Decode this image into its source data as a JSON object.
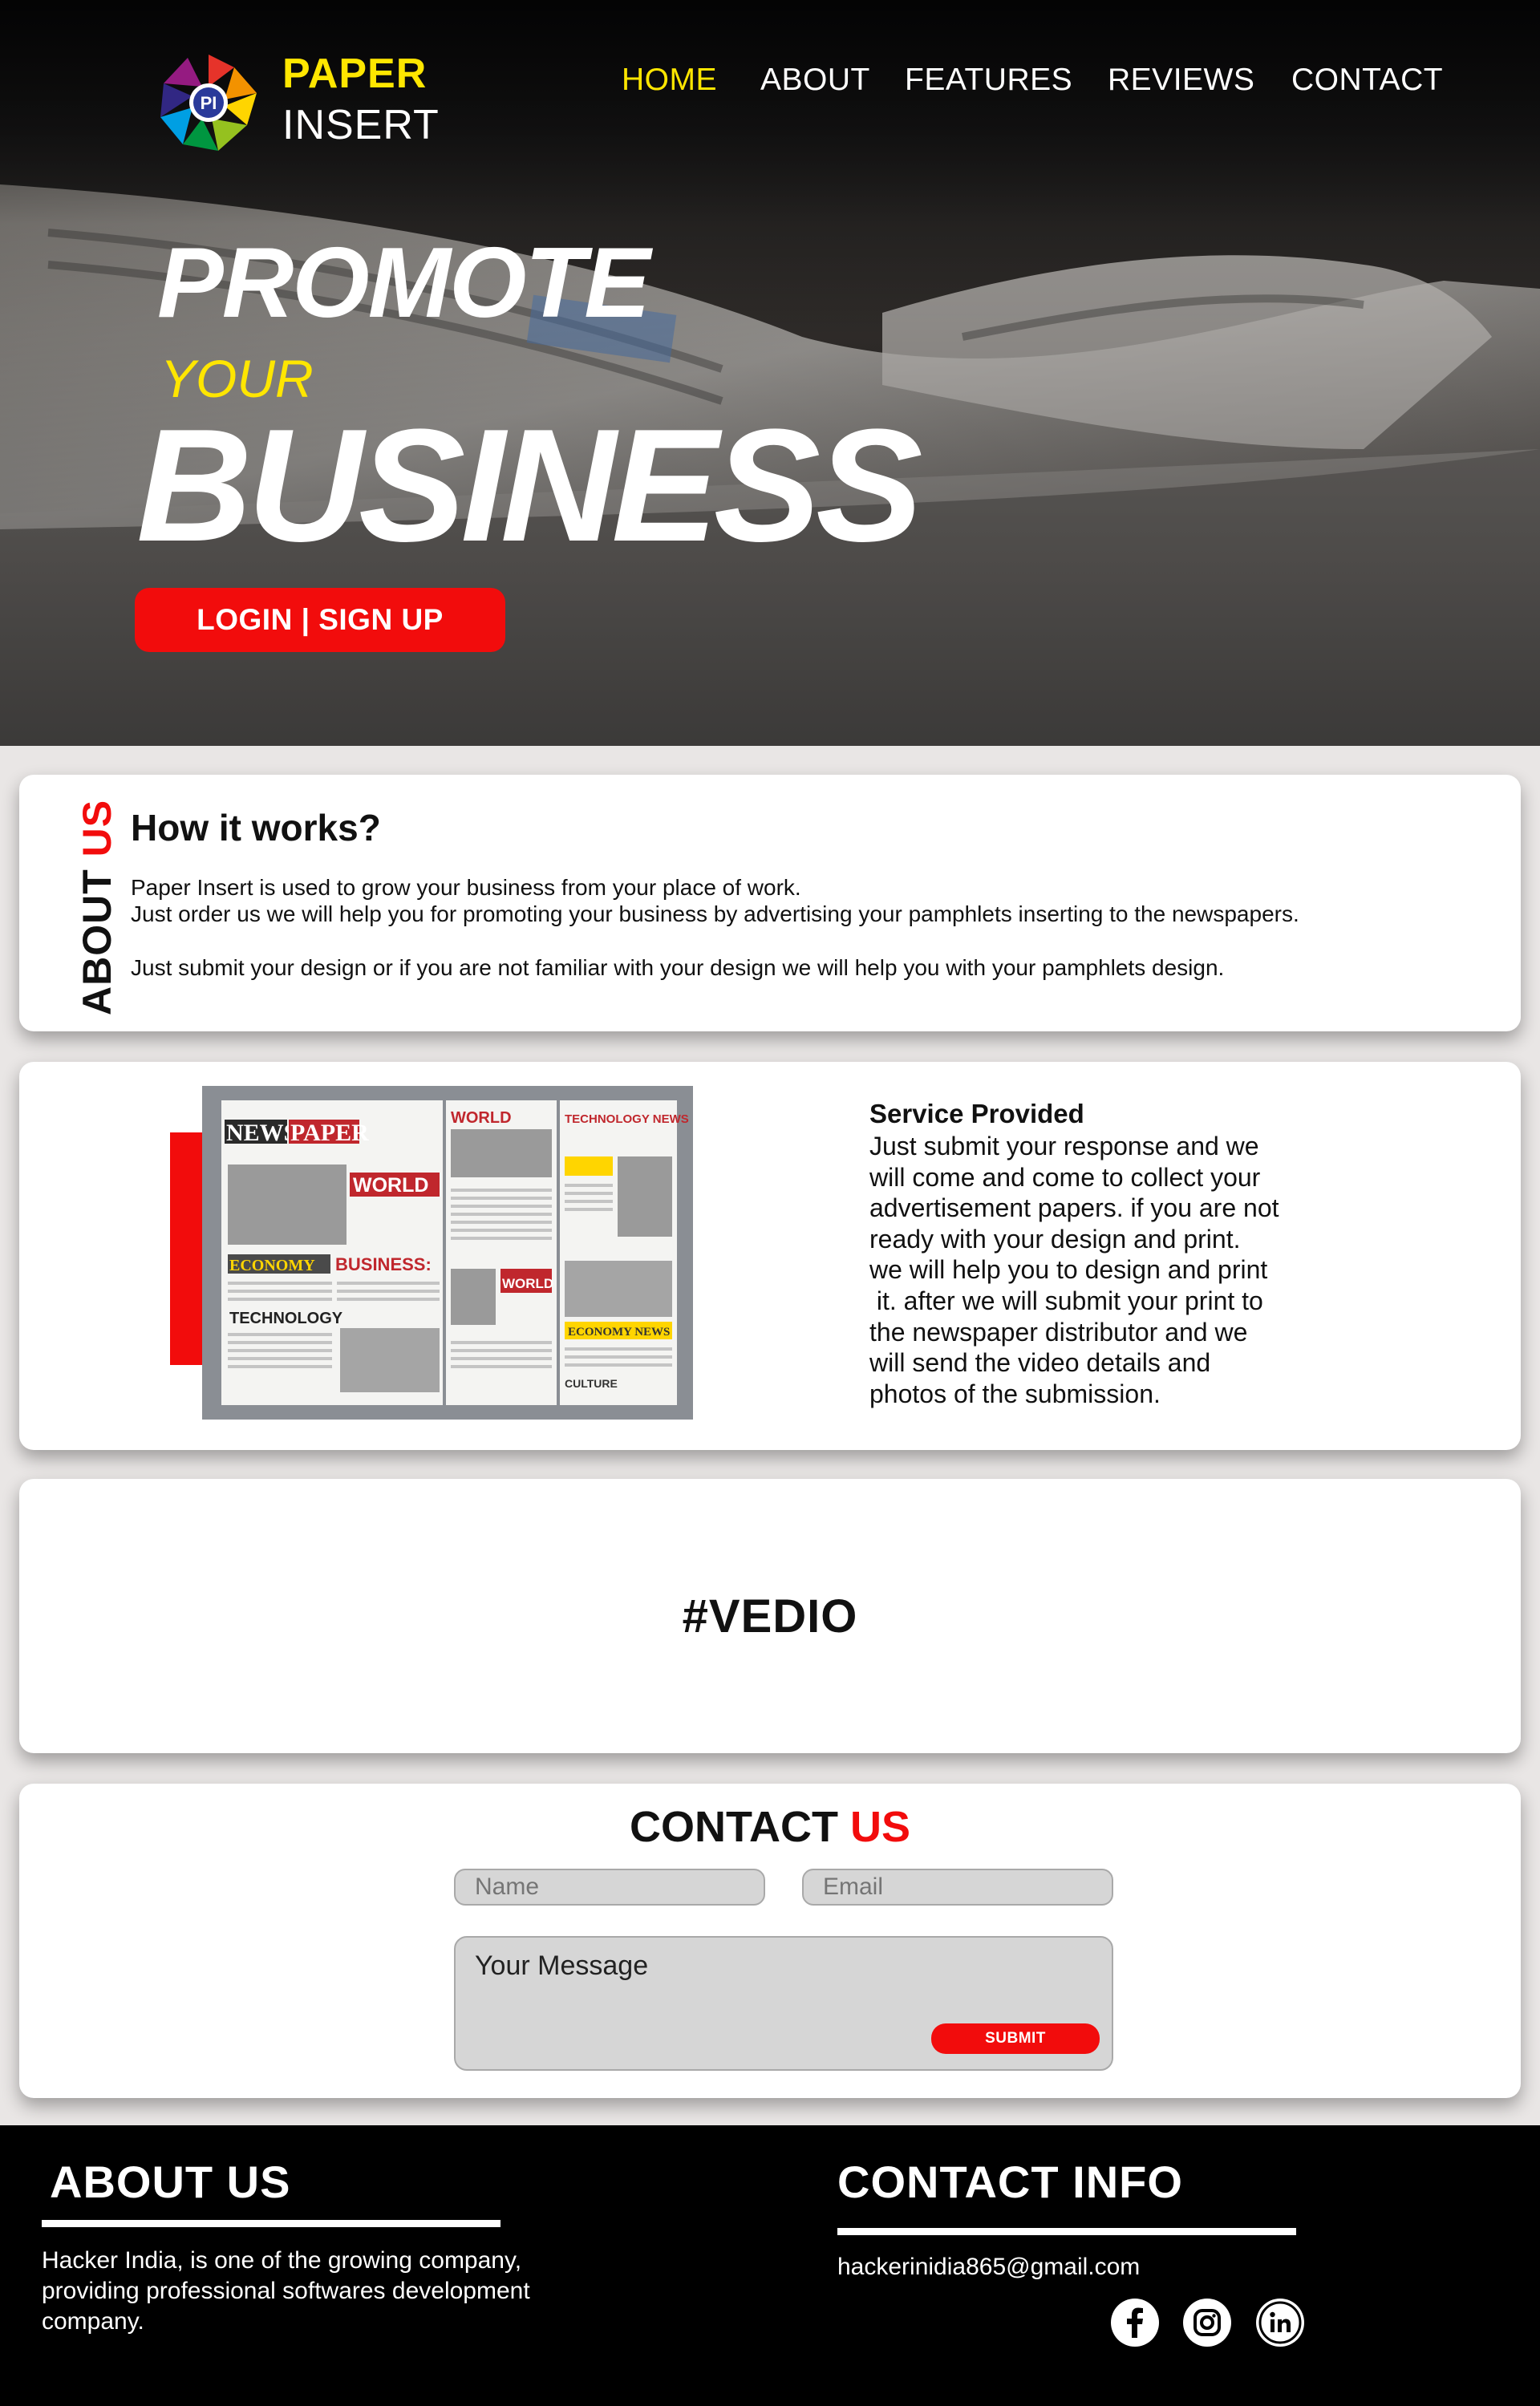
{
  "brand": {
    "line1": "PAPER",
    "line2": "INSERT",
    "logo_text": "PI"
  },
  "nav": [
    {
      "label": "HOME",
      "active": true
    },
    {
      "label": "ABOUT",
      "active": false
    },
    {
      "label": "FEATURES",
      "active": false
    },
    {
      "label": "REVIEWS",
      "active": false
    },
    {
      "label": "CONTACT",
      "active": false
    }
  ],
  "hero": {
    "line1": "PROMOTE",
    "line2": "YOUR",
    "line3": "BUSINESS",
    "button": "LOGIN | SIGN UP"
  },
  "about_card": {
    "side_label_1": "ABOUT ",
    "side_label_2": "US",
    "title": "How it works?",
    "p1": "Paper Insert is used to grow your business from your place of work.",
    "p2": "Just order us we will help you for promoting your business by advertising your pamphlets inserting to the newspapers.",
    "p3": "Just submit your design or if you are not familiar with your design we will help you with your pamphlets design."
  },
  "service_card": {
    "title": "Service Provided",
    "lines": [
      "Just submit your response and we",
      "will come and come to collect your",
      "advertisement papers. if you are not",
      "ready with your design and print.",
      "we will help you to design and print",
      " it. after we will submit your print to",
      "the newspaper distributor and we",
      "will send the video details and",
      "photos of the submission."
    ],
    "newspaper": {
      "masthead_1": "NEWS",
      "masthead_2": "PAPER",
      "world": "WORLD",
      "economy": "ECONOMY",
      "business": "BUSINESS:",
      "technology": "TECHNOLOGY",
      "world_2": "WORLD",
      "technology_news": "TECHNOLOGY NEWS",
      "economy_news": "ECONOMY NEWS",
      "culture": "CULTURE"
    }
  },
  "video_card": {
    "label": "#VEDIO"
  },
  "contact_card": {
    "title_1": "CONTACT ",
    "title_2": "US",
    "name_placeholder": "Name",
    "email_placeholder": "Email",
    "message_placeholder": "Your Message",
    "submit": "SUBMIT"
  },
  "footer": {
    "about_title": "ABOUT US",
    "about_lines": [
      "Hacker India, is one of the growing company,",
      "providing professional softwares development",
      "company."
    ],
    "contact_title": "CONTACT INFO",
    "email": "hackerinidia865@gmail.com",
    "social": [
      "facebook-icon",
      "instagram-icon",
      "linkedin-icon"
    ]
  },
  "colors": {
    "accent_red": "#f20c0c",
    "accent_yellow": "#ffe600",
    "footer_bg": "#000000"
  }
}
